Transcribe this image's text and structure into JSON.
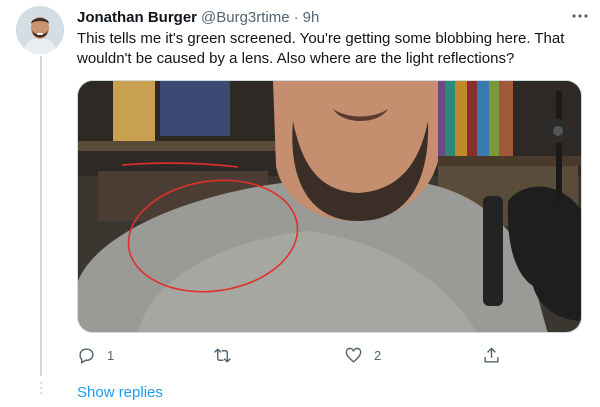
{
  "tweet": {
    "author_name": "Jonathan Burger",
    "handle": "@Burg3rtime",
    "separator": "·",
    "time": "9h",
    "text": "This tells me it's green screened. You're getting some blobbing here. That wouldn't be caused by a lens. Also where are the light reflections?",
    "media_description_icon": "video-still-image"
  },
  "actions": {
    "reply_count": "1",
    "retweet_count": "",
    "like_count": "2",
    "share_count": ""
  },
  "thread": {
    "show_replies_label": "Show replies"
  },
  "colors": {
    "accent": "#1d9bf0",
    "secondary_text": "#536471",
    "annotation": "#e0302a"
  }
}
